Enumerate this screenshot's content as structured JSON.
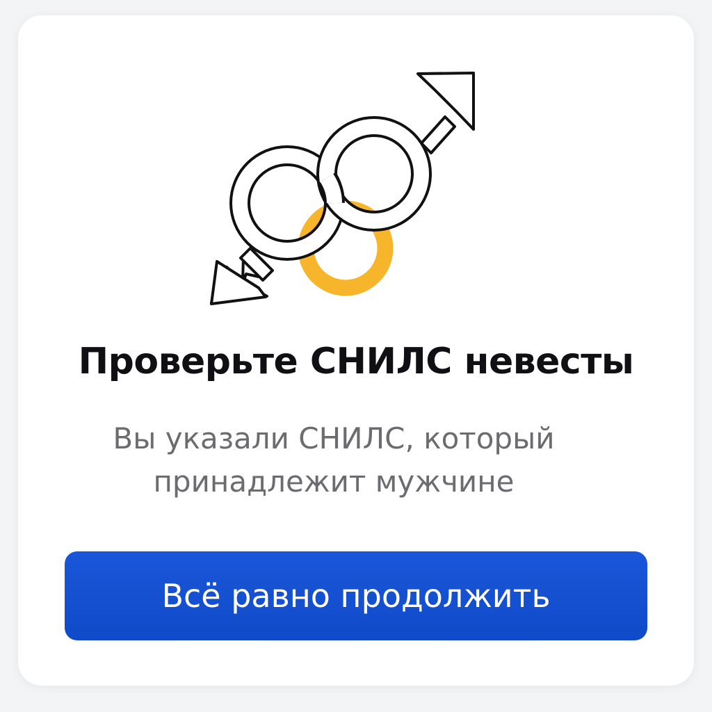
{
  "dialog": {
    "title": "Проверьте СНИЛС невесты",
    "message": "Вы указали СНИЛС, который принадлежит мужчине",
    "continue_label": "Всё равно продолжить"
  },
  "illustration": {
    "icon": "linked-male-symbols-with-ring-icon",
    "ring_color": "#f7b52c",
    "stroke_color": "#111111"
  },
  "colors": {
    "button": "#1250d3",
    "title": "#0f0f14",
    "message": "#6b6b70"
  }
}
